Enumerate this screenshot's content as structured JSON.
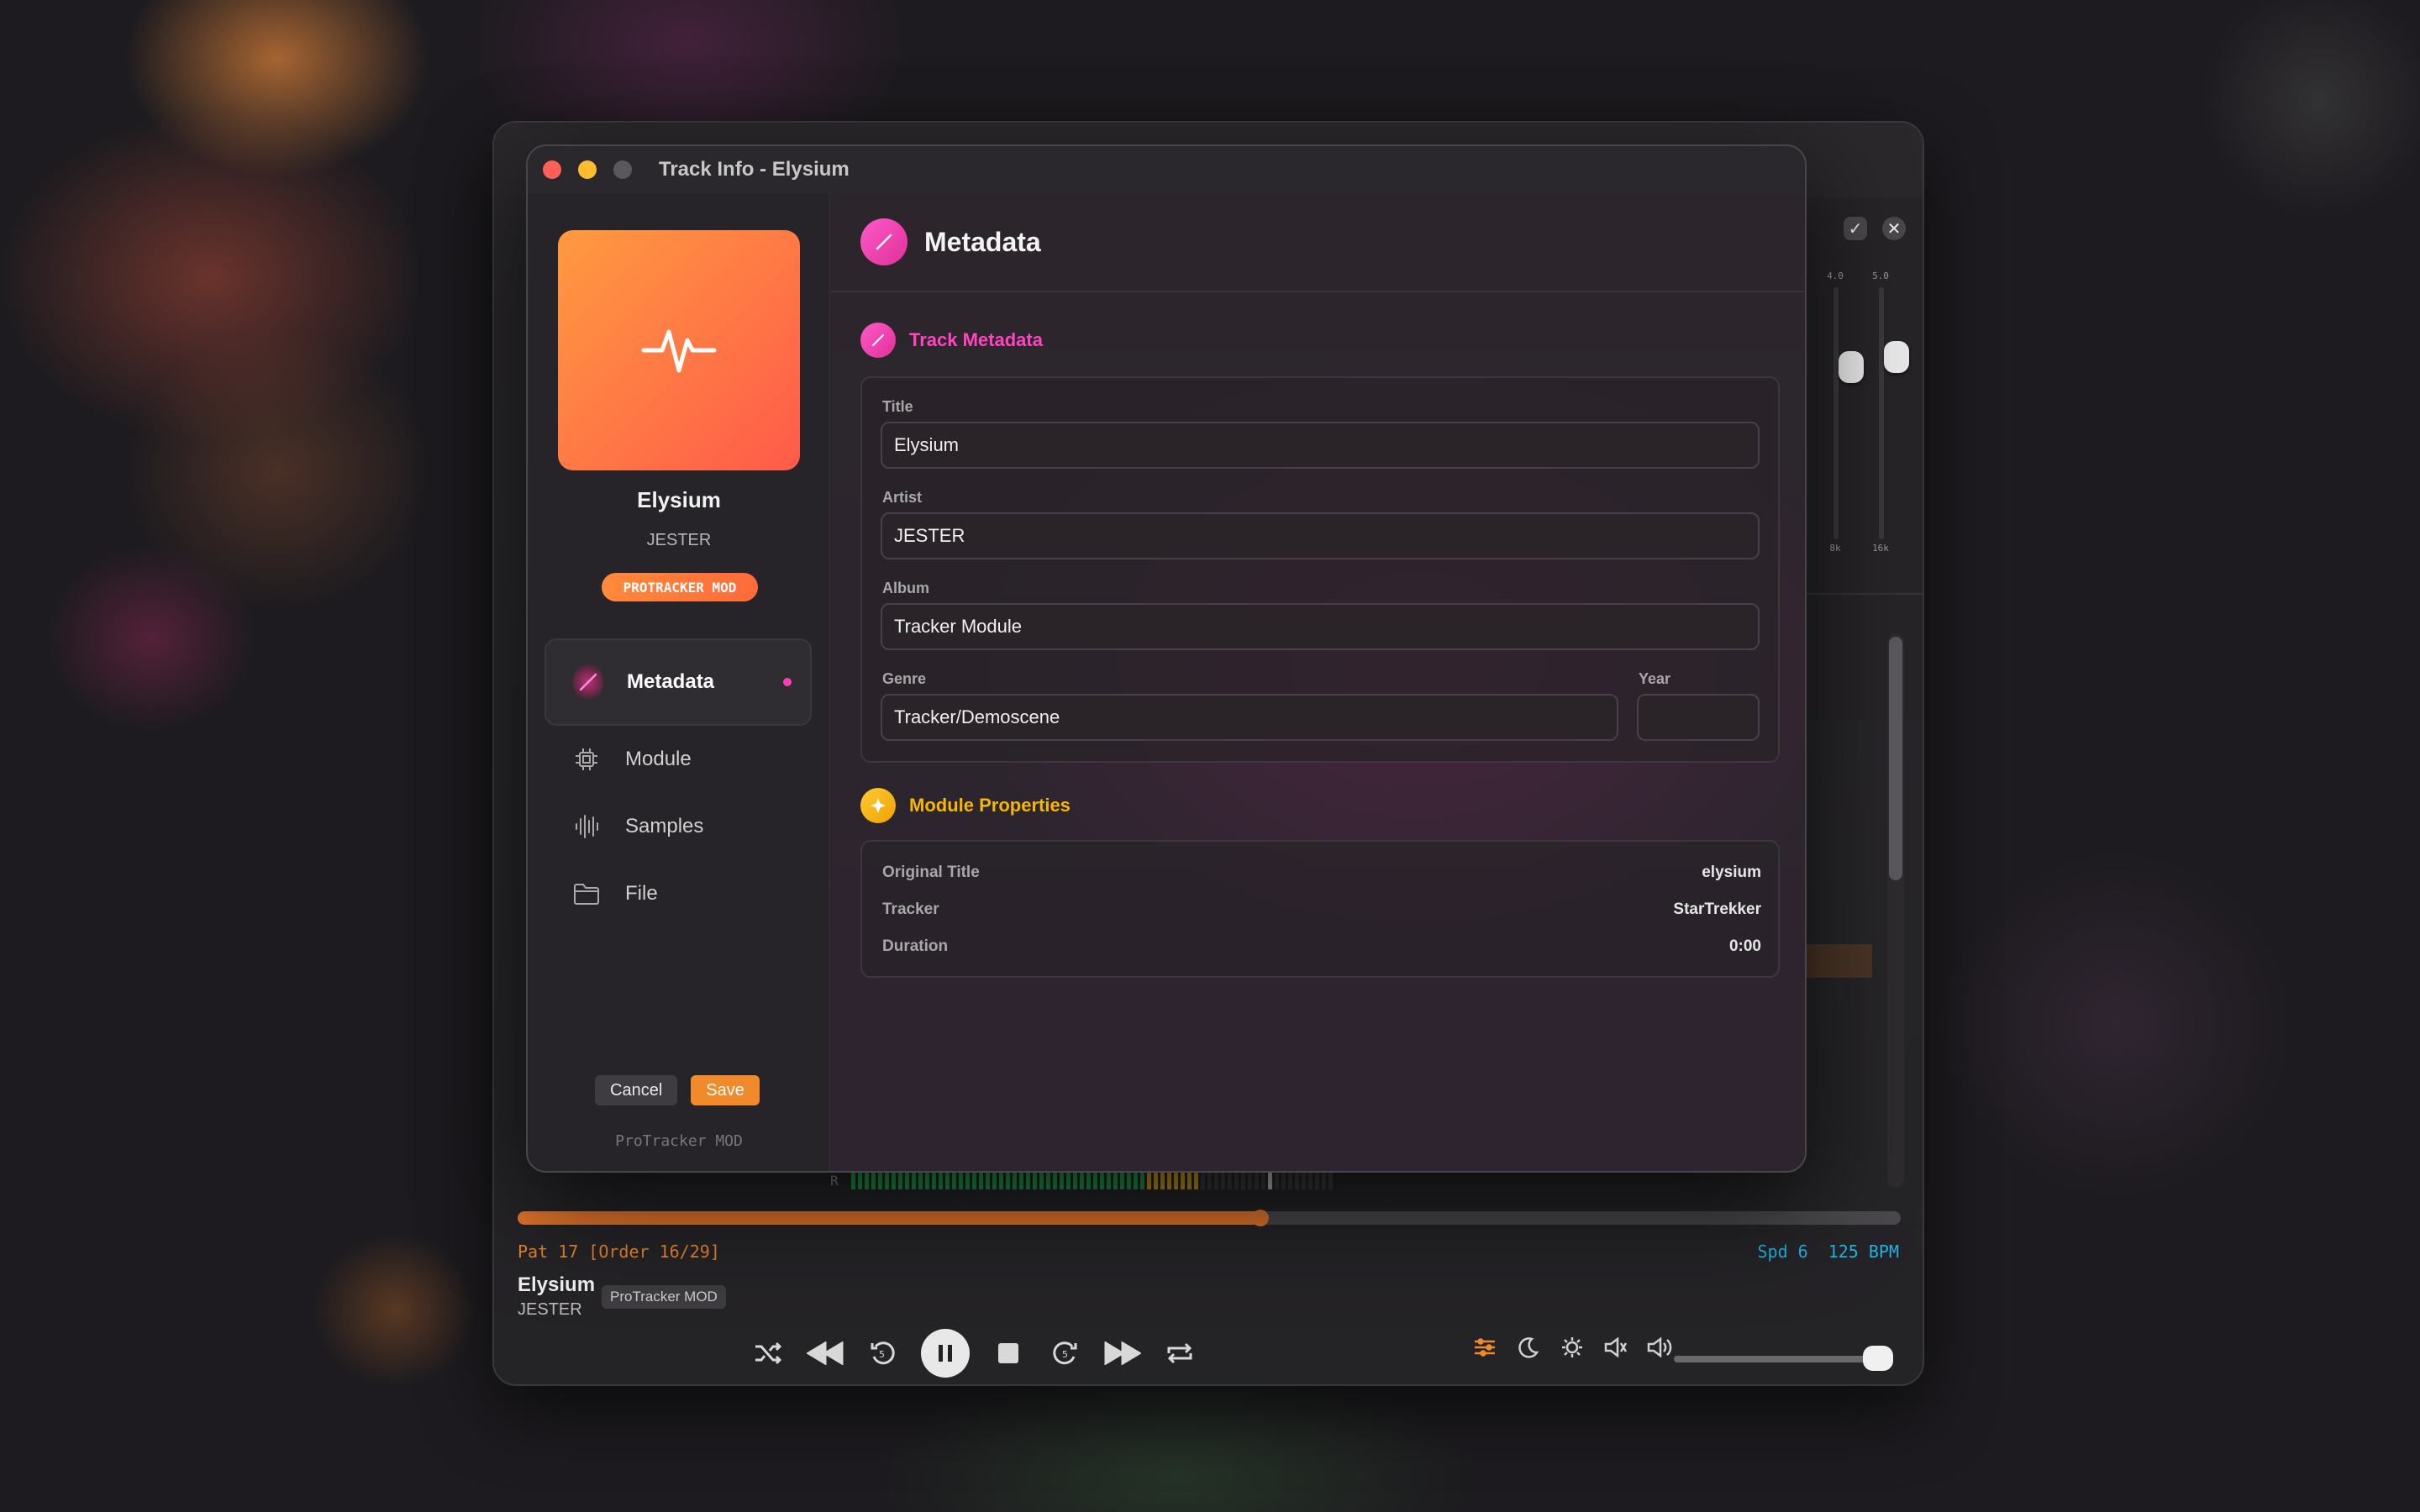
{
  "player": {
    "eq": {
      "values": [
        "4.0",
        "5.0"
      ],
      "bands": [
        "8k",
        "16k"
      ],
      "levels": [
        0.62,
        0.66
      ]
    },
    "vu_label": "R",
    "progress": 0.537,
    "pattern_text": "Pat 17 [Order 16/29]",
    "speed_text": "Spd 6",
    "bpm_text": "125 BPM",
    "now_playing_title": "Elysium",
    "now_playing_artist": "JESTER",
    "now_playing_format": "ProTracker MOD",
    "volume": 0.97,
    "transport_icons": [
      "shuffle-icon",
      "rewind-icon",
      "skip-back-5-icon",
      "pause-icon",
      "stop-icon",
      "skip-forward-5-icon",
      "fast-forward-icon",
      "repeat-icon"
    ],
    "right_icons": [
      "equalizer-icon",
      "sleep-moon-icon",
      "visualizer-icon",
      "speaker-icon",
      "volume-icon"
    ]
  },
  "dialog": {
    "window_title": "Track Info - Elysium",
    "sidebar": {
      "track_title": "Elysium",
      "track_artist": "JESTER",
      "format_badge": "PROTRACKER MOD",
      "nav": [
        {
          "label": "Metadata",
          "icon": "pencil-icon",
          "active": true
        },
        {
          "label": "Module",
          "icon": "chip-icon",
          "active": false
        },
        {
          "label": "Samples",
          "icon": "waveform-icon",
          "active": false
        },
        {
          "label": "File",
          "icon": "folder-icon",
          "active": false
        }
      ],
      "cancel_label": "Cancel",
      "save_label": "Save",
      "footer": "ProTracker MOD"
    },
    "content": {
      "header_title": "Metadata",
      "track_metadata": {
        "section_title": "Track Metadata",
        "title_label": "Title",
        "title_value": "Elysium",
        "artist_label": "Artist",
        "artist_value": "JESTER",
        "album_label": "Album",
        "album_value": "Tracker Module",
        "genre_label": "Genre",
        "genre_value": "Tracker/Demoscene",
        "year_label": "Year",
        "year_value": ""
      },
      "module_properties": {
        "section_title": "Module Properties",
        "rows": [
          {
            "key": "Original Title",
            "value": "elysium"
          },
          {
            "key": "Tracker",
            "value": "StarTrekker"
          },
          {
            "key": "Duration",
            "value": "0:00"
          }
        ]
      }
    }
  },
  "colors": {
    "accent_orange": "#f08a2a",
    "accent_pink": "#ff3fb8",
    "accent_yellow": "#f5b800",
    "info_blue": "#1fb5e6"
  }
}
